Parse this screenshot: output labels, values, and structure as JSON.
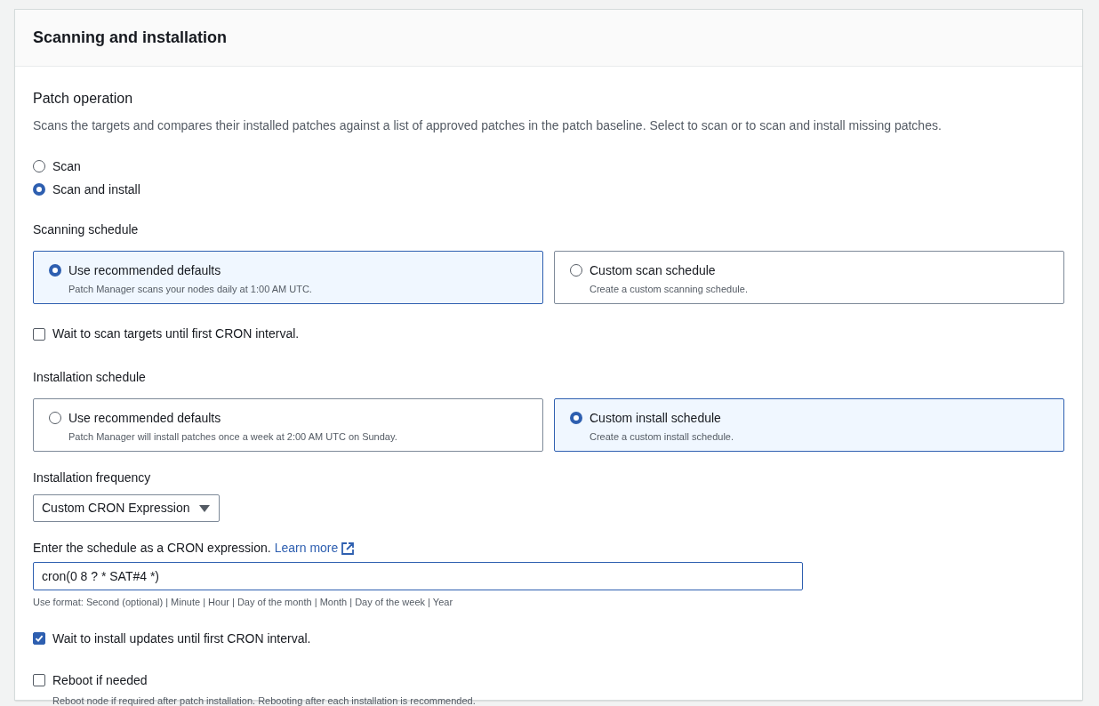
{
  "panel": {
    "title": "Scanning and installation"
  },
  "patch_operation": {
    "label": "Patch operation",
    "description": "Scans the targets and compares their installed patches against a list of approved patches in the patch baseline. Select to scan or to scan and install missing patches.",
    "options": [
      {
        "label": "Scan",
        "selected": false
      },
      {
        "label": "Scan and install",
        "selected": true
      }
    ]
  },
  "scanning_schedule": {
    "label": "Scanning schedule",
    "tiles": [
      {
        "label": "Use recommended defaults",
        "description": "Patch Manager scans your nodes daily at 1:00 AM UTC.",
        "selected": true
      },
      {
        "label": "Custom scan schedule",
        "description": "Create a custom scanning schedule.",
        "selected": false
      }
    ]
  },
  "scan_wait": {
    "label": "Wait to scan targets until first CRON interval.",
    "checked": false
  },
  "installation_schedule": {
    "label": "Installation schedule",
    "tiles": [
      {
        "label": "Use recommended defaults",
        "description": "Patch Manager will install patches once a week at 2:00 AM UTC on Sunday.",
        "selected": false
      },
      {
        "label": "Custom install schedule",
        "description": "Create a custom install schedule.",
        "selected": true
      }
    ]
  },
  "installation_frequency": {
    "label": "Installation frequency",
    "value": "Custom CRON Expression"
  },
  "cron": {
    "label": "Enter the schedule as a CRON expression.",
    "link": "Learn more",
    "value": "cron(0 8 ? * SAT#4 *)",
    "hint": "Use format: Second (optional) | Minute | Hour | Day of the month | Month | Day of the week | Year"
  },
  "install_wait": {
    "label": "Wait to install updates until first CRON interval.",
    "checked": true
  },
  "reboot": {
    "label": "Reboot if needed",
    "description": "Reboot node if required after patch installation. Rebooting after each installation is recommended.",
    "checked": false
  }
}
